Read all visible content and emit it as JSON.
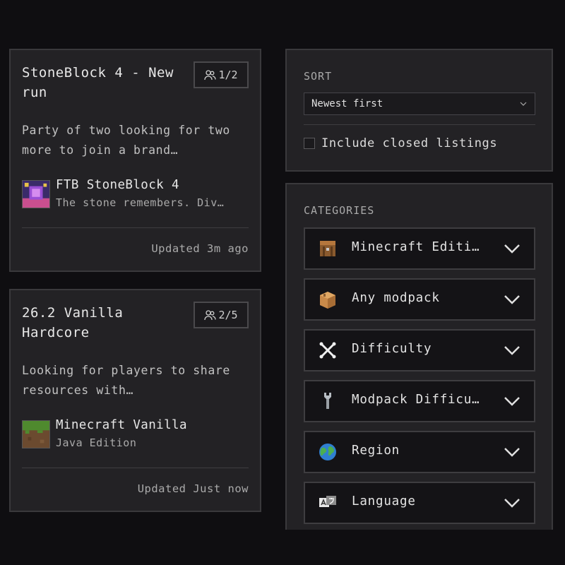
{
  "listings": [
    {
      "title": "StoneBlock 4 - New run",
      "players": "1/2",
      "description": "Party of two looking for two more to join a brand…",
      "pack_name": "FTB StoneBlock 4",
      "pack_subtitle": "The stone remembers. Div…",
      "updated": "Updated 3m ago"
    },
    {
      "title": "26.2 Vanilla Hardcore",
      "players": "2/5",
      "description": "Looking for players to share resources with…",
      "pack_name": "Minecraft Vanilla",
      "pack_subtitle": "Java Edition",
      "updated": "Updated Just now"
    }
  ],
  "sort": {
    "label": "SORT",
    "selected": "Newest first",
    "include_closed_label": "Include closed listings",
    "include_closed": false
  },
  "categories": {
    "label": "CATEGORIES",
    "items": [
      {
        "label": "Minecraft Editi…",
        "icon": "crafting-table-icon"
      },
      {
        "label": "Any modpack",
        "icon": "package-icon"
      },
      {
        "label": "Difficulty",
        "icon": "crossed-bones-icon"
      },
      {
        "label": "Modpack Difficu…",
        "icon": "wrench-icon"
      },
      {
        "label": "Region",
        "icon": "globe-icon"
      },
      {
        "label": "Language",
        "icon": "language-icon"
      }
    ]
  }
}
